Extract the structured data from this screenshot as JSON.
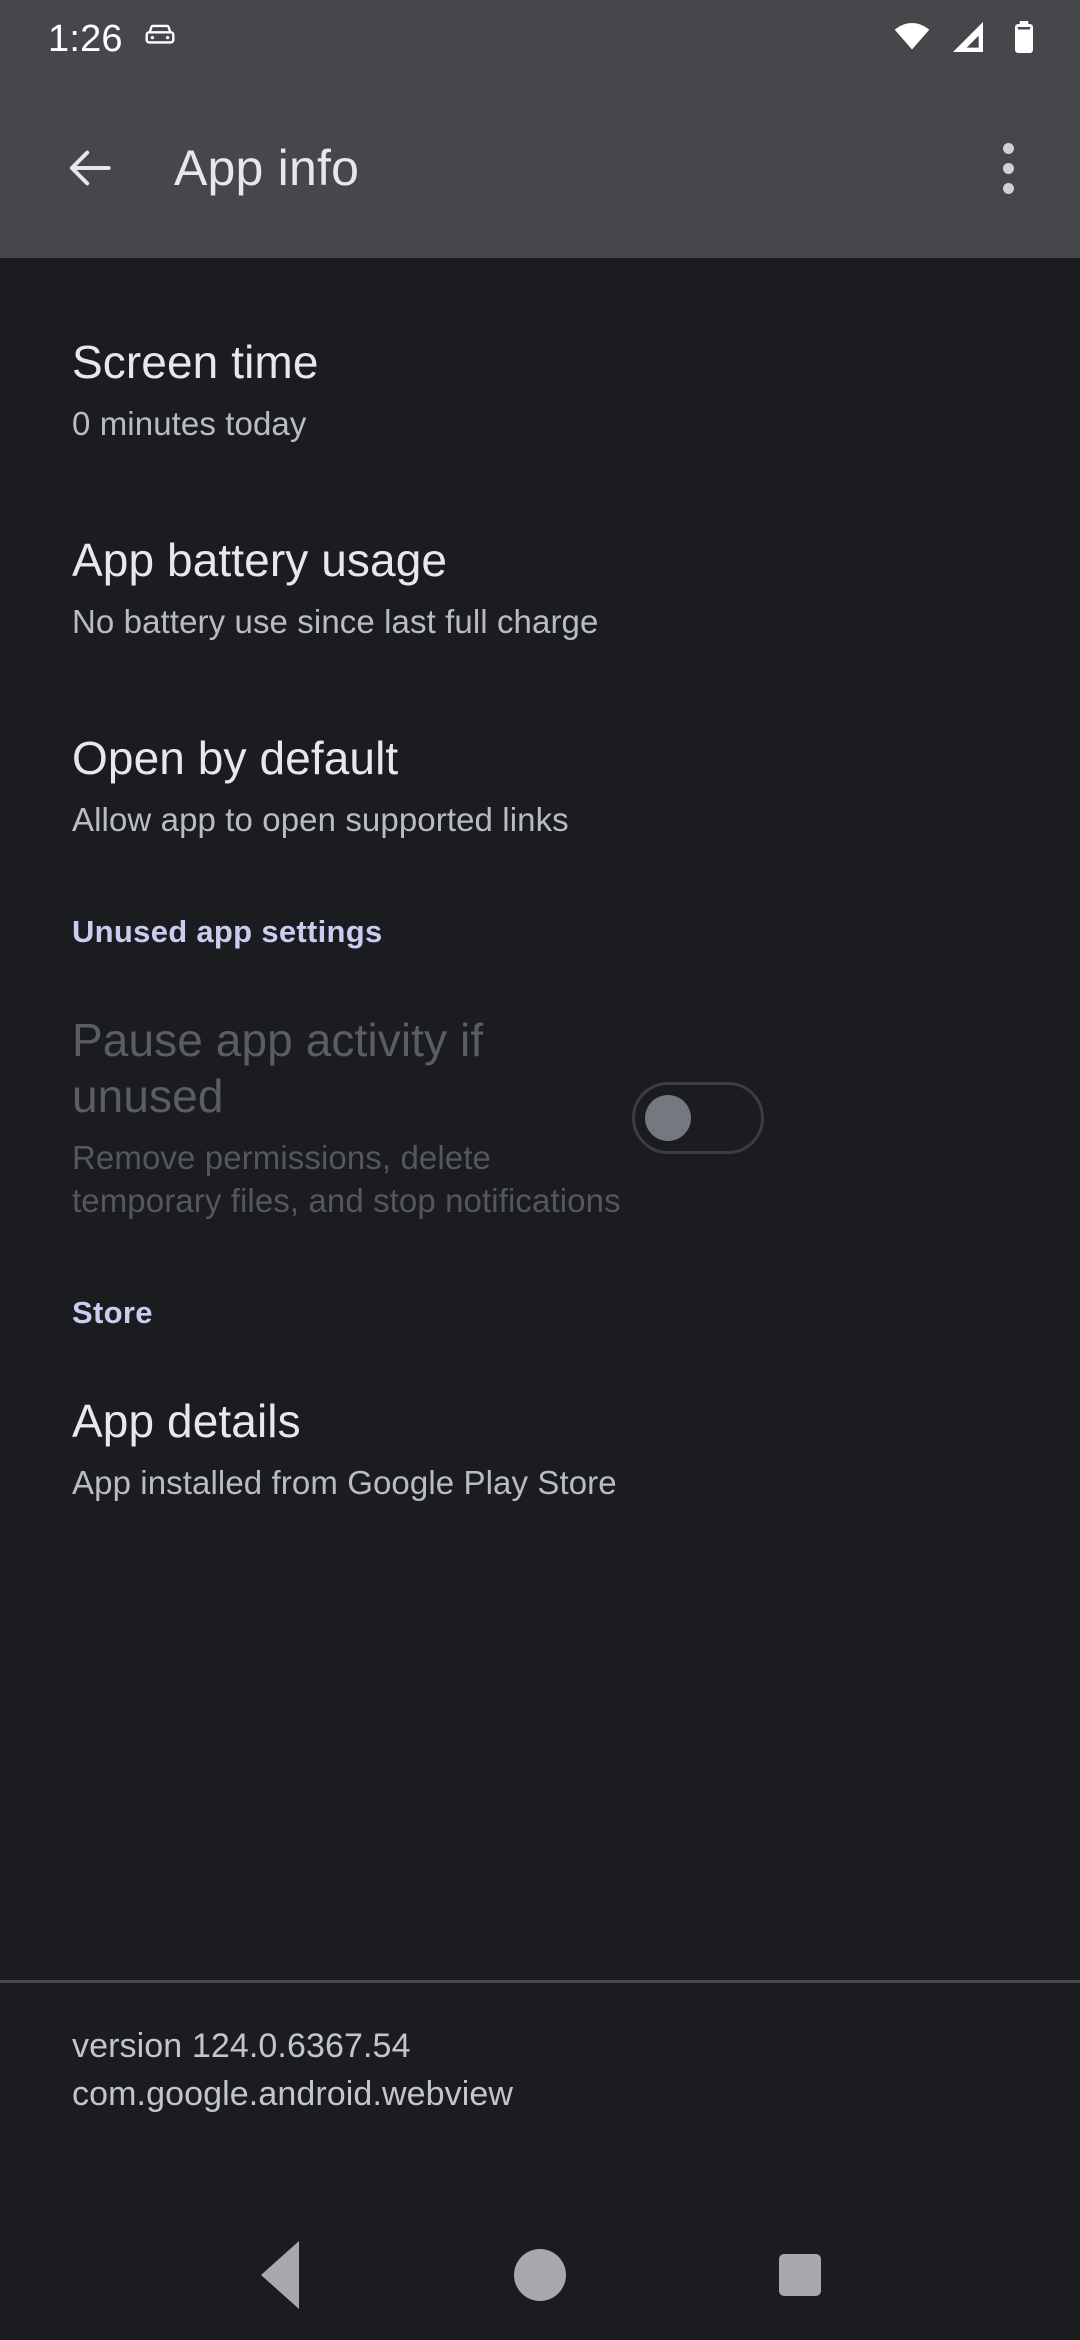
{
  "status_bar": {
    "time": "1:26",
    "icons": [
      "car-icon",
      "wifi-icon",
      "cellular-signal-icon",
      "battery-icon"
    ]
  },
  "app_bar": {
    "back_label": "back-arrow",
    "title": "App info",
    "overflow_label": "more-options"
  },
  "items": [
    {
      "title": "Screen time",
      "subtitle": "0 minutes today"
    },
    {
      "title": "App battery usage",
      "subtitle": "No battery use since last full charge"
    },
    {
      "title": "Open by default",
      "subtitle": "Allow app to open supported links"
    }
  ],
  "unused_section": {
    "header": "Unused app settings",
    "toggle_row": {
      "title": "Pause app activity if unused",
      "subtitle": "Remove permissions, delete temporary files, and stop notifications",
      "enabled": false,
      "checked": false
    }
  },
  "store_section": {
    "header": "Store",
    "item": {
      "title": "App details",
      "subtitle": "App installed from Google Play Store"
    }
  },
  "footer": {
    "version": "version 124.0.6367.54",
    "package": "com.google.android.webview"
  },
  "nav_bar": {
    "back": "nav-back",
    "home": "nav-home",
    "recents": "nav-recents"
  },
  "colors": {
    "background": "#1b1c20",
    "bar": "#45474b",
    "accent": "#c9cdf0",
    "primary_text": "#e7e8ec",
    "secondary_text": "#b9bcc4",
    "disabled_text": "#5a5d64"
  }
}
